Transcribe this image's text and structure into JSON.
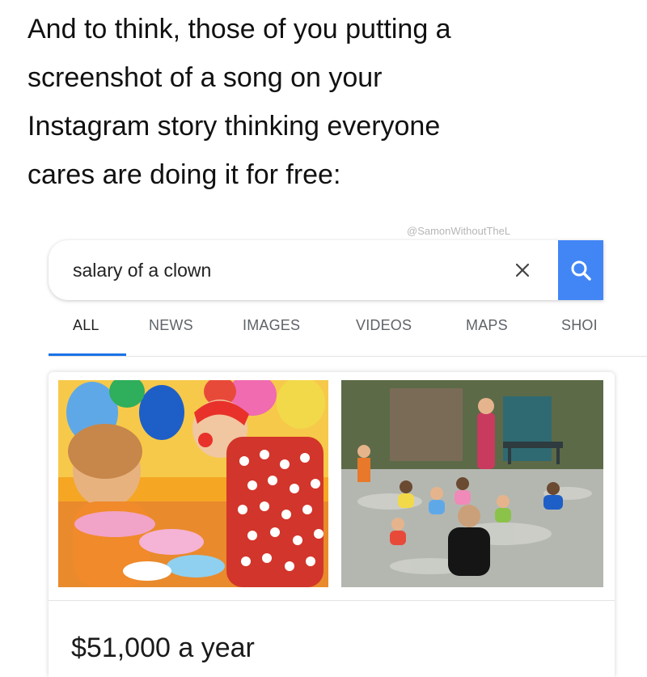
{
  "caption": {
    "line1": "And to think, those of you putting a",
    "line2": "screenshot of a song on your",
    "line3": "Instagram story thinking everyone",
    "line4": "cares are doing it for free:"
  },
  "watermark": "@SamonWithoutTheL",
  "search": {
    "query": "salary of a clown",
    "clear_icon": "close-icon",
    "submit_icon": "search-icon"
  },
  "tabs": [
    {
      "label": "ALL",
      "active": true
    },
    {
      "label": "NEWS",
      "active": false
    },
    {
      "label": "IMAGES",
      "active": false
    },
    {
      "label": "VIDEOS",
      "active": false
    },
    {
      "label": "MAPS",
      "active": false
    },
    {
      "label": "SHOI",
      "active": false
    }
  ],
  "result": {
    "answer": "$51,000 a year"
  },
  "colors": {
    "accent": "#4286f5",
    "tab_underline": "#1a73e8",
    "tab_text": "#5f6368"
  }
}
